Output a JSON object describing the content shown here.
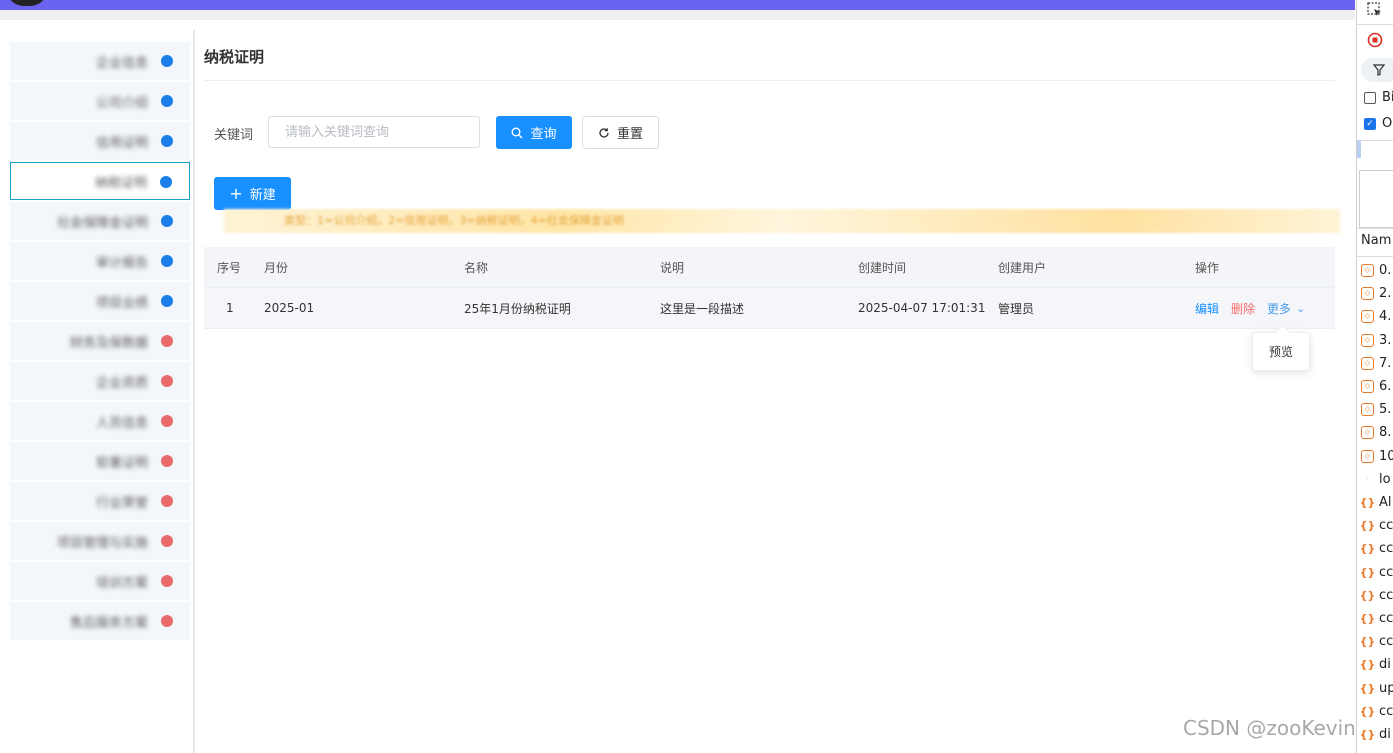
{
  "sidebar": {
    "items": [
      {
        "label": "企业信息",
        "dot": "blue"
      },
      {
        "label": "公司介绍",
        "dot": "blue"
      },
      {
        "label": "信用证明",
        "dot": "blue"
      },
      {
        "label": "纳税证明",
        "dot": "blue",
        "active": true
      },
      {
        "label": "社会保障金证明",
        "dot": "blue"
      },
      {
        "label": "审计报告",
        "dot": "blue"
      },
      {
        "label": "项目业绩",
        "dot": "blue"
      },
      {
        "label": "财务及保数据",
        "dot": "red"
      },
      {
        "label": "企业资质",
        "dot": "red"
      },
      {
        "label": "人员信息",
        "dot": "red"
      },
      {
        "label": "软著证明",
        "dot": "red"
      },
      {
        "label": "行业荣誉",
        "dot": "red"
      },
      {
        "label": "项目管理与实施",
        "dot": "red"
      },
      {
        "label": "培训方案",
        "dot": "red"
      },
      {
        "label": "售后服务方案",
        "dot": "red"
      }
    ]
  },
  "main": {
    "title": "纳税证明",
    "filter": {
      "keyword_label": "关键词",
      "keyword_placeholder": "请输入关键词查询",
      "keyword_value": "",
      "query_label": "查询",
      "reset_label": "重置"
    },
    "new_label": "新建",
    "notice": "类型：1=公司介绍，2=信用证明，3=纳税证明，4=社会保障金证明"
  },
  "table": {
    "columns": [
      "序号",
      "月份",
      "名称",
      "说明",
      "创建时间",
      "创建用户",
      "操作"
    ],
    "rows": [
      {
        "index": "1",
        "month": "2025-01",
        "name": "25年1月份纳税证明",
        "desc": "这里是一段描述",
        "created": "2025-04-07 17:01:31",
        "user": "管理员"
      }
    ],
    "actions": {
      "edit": "编辑",
      "delete": "删除",
      "more": "更多"
    },
    "more_menu": [
      "预览"
    ]
  },
  "devtools": {
    "checkbox1": "Bi",
    "checkbox1_checked": false,
    "checkbox2": "O",
    "checkbox2_checked": true,
    "name_header": "Nam",
    "requests": [
      {
        "name": "0.",
        "icon": "doc"
      },
      {
        "name": "2.",
        "icon": "doc"
      },
      {
        "name": "4.",
        "icon": "doc"
      },
      {
        "name": "3.",
        "icon": "doc"
      },
      {
        "name": "7.",
        "icon": "doc"
      },
      {
        "name": "6.",
        "icon": "doc"
      },
      {
        "name": "5.",
        "icon": "doc"
      },
      {
        "name": "8.",
        "icon": "doc"
      },
      {
        "name": "10",
        "icon": "doc"
      },
      {
        "name": "lo",
        "icon": "plain"
      },
      {
        "name": "Al",
        "icon": "brace"
      },
      {
        "name": "cc",
        "icon": "brace"
      },
      {
        "name": "cc",
        "icon": "brace"
      },
      {
        "name": "cc",
        "icon": "brace"
      },
      {
        "name": "cc",
        "icon": "brace"
      },
      {
        "name": "cc",
        "icon": "brace"
      },
      {
        "name": "cc",
        "icon": "brace"
      },
      {
        "name": "di",
        "icon": "brace"
      },
      {
        "name": "up",
        "icon": "brace"
      },
      {
        "name": "cc",
        "icon": "brace"
      },
      {
        "name": "di",
        "icon": "brace"
      }
    ]
  },
  "watermark": "CSDN @zooKevin",
  "colors": {
    "primary": "#1890ff",
    "danger": "#f56c6c",
    "topbar": "#6a63f0",
    "dot_blue": "#1a7fe8",
    "dot_red": "#e86a6a"
  }
}
